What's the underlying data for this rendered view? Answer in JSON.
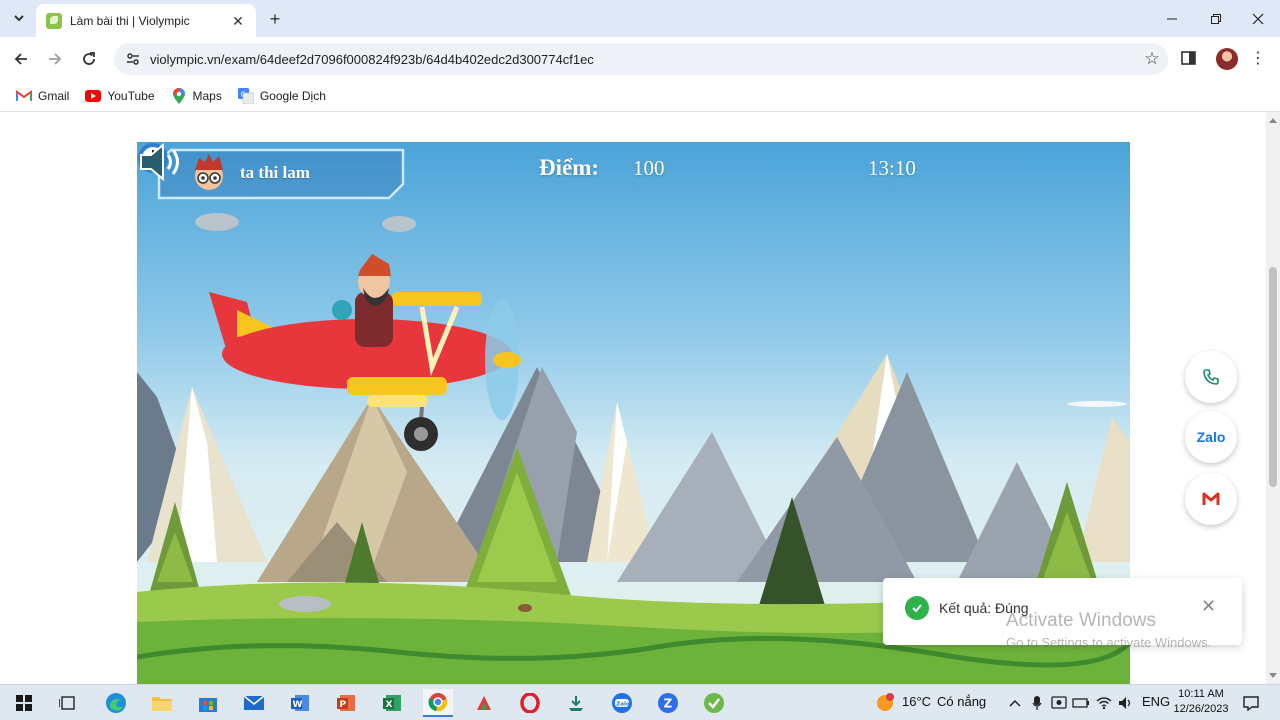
{
  "browser": {
    "tab": {
      "title": "Làm bài thi | Violympic"
    },
    "url": "violympic.vn/exam/64deef2d7096f000824f923b/64d4b402edc2d300774cf1ec",
    "bookmarks": [
      {
        "label": "Gmail",
        "icon": "gmail-icon"
      },
      {
        "label": "YouTube",
        "icon": "youtube-icon"
      },
      {
        "label": "Maps",
        "icon": "maps-icon"
      },
      {
        "label": "Google Dịch",
        "icon": "google-translate-icon"
      }
    ]
  },
  "game": {
    "player_name": "ta thi lam",
    "score_label": "Điểm:",
    "score": "100",
    "timer": "13:10"
  },
  "contact": {
    "zalo_label": "Zalo"
  },
  "toast": {
    "message": "Kết quả: Đúng"
  },
  "watermark": {
    "line1": "Activate Windows",
    "line2": "Go to Settings to activate Windows."
  },
  "taskbar": {
    "weather": {
      "temp": "16°C",
      "condition": "Có nắng"
    },
    "language": "ENG",
    "time": "10:11 AM",
    "date": "12/26/2023"
  },
  "colors": {
    "sky_top": "#4aa3d9",
    "grass": "#7cc242",
    "plane_red": "#e8363d",
    "plane_yellow": "#f7c520",
    "toast_success": "#2db34a"
  }
}
